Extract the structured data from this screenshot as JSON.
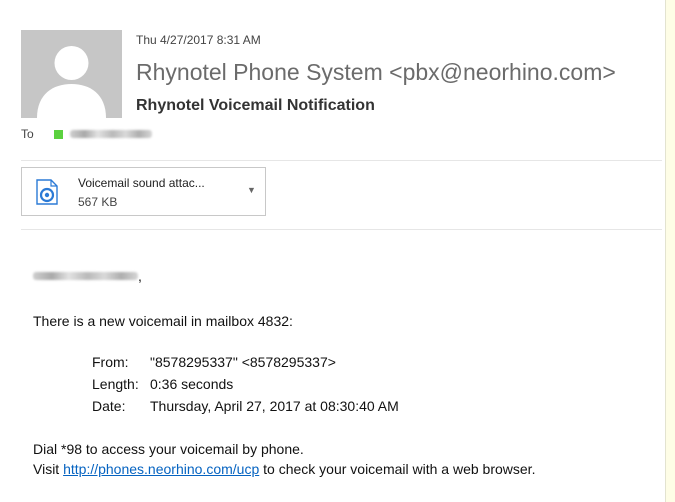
{
  "header": {
    "date": "Thu 4/27/2017 8:31 AM",
    "sender": "Rhynotel Phone System <pbx@neorhino.com>",
    "subject": "Rhynotel Voicemail Notification",
    "to_label": "To"
  },
  "attachment": {
    "name": "Voicemail sound attac...",
    "size": "567 KB",
    "icon": "audio-file-icon"
  },
  "body": {
    "greeting_suffix": ",",
    "intro": "There is a new voicemail in mailbox 4832:",
    "from_label": "From:",
    "from_value": "\"8578295337\" <8578295337>",
    "length_label": "Length:",
    "length_value": "0:36 seconds",
    "date_label": "Date:",
    "date_value": "Thursday, April 27, 2017 at 08:30:40 AM",
    "dial_line": "Dial *98 to access your voicemail by phone.",
    "visit_prefix": "Visit",
    "visit_link": "http://phones.neorhino.com/ucp",
    "visit_suffix": "to check your voicemail with a web browser."
  },
  "colors": {
    "presence": "#5bd13f",
    "link": "#0563c1",
    "sender": "#6b6b6b"
  }
}
